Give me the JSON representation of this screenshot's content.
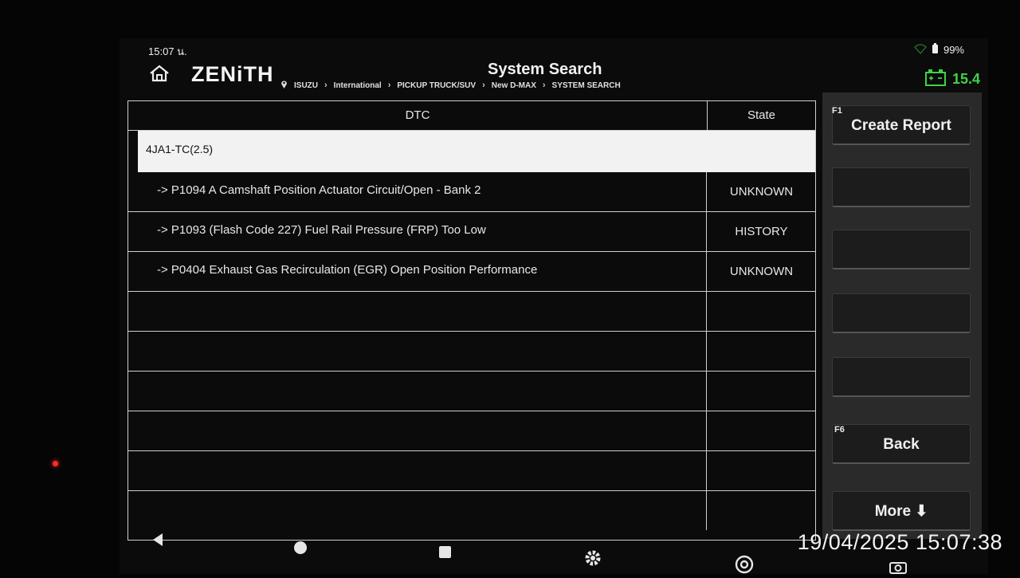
{
  "status_bar": {
    "time": "15:07 น.",
    "battery": "99%"
  },
  "header": {
    "logo": "ZENiTH",
    "title": "System Search",
    "breadcrumb": [
      "ISUZU",
      "International",
      "PICKUP TRUCK/SUV",
      "New D-MAX",
      "SYSTEM SEARCH"
    ],
    "voltage": "15.4"
  },
  "table": {
    "columns": {
      "dtc": "DTC",
      "state": "State"
    },
    "group": "4JA1-TC(2.5)",
    "rows": [
      {
        "dtc": "->  P1094 A Camshaft Position Actuator Circuit/Open - Bank 2",
        "state": "UNKNOWN"
      },
      {
        "dtc": "->  P1093 (Flash Code 227) Fuel Rail Pressure (FRP) Too Low",
        "state": "HISTORY"
      },
      {
        "dtc": "->  P0404 Exhaust Gas Recirculation (EGR) Open Position Performance",
        "state": "UNKNOWN"
      },
      {
        "dtc": "",
        "state": ""
      },
      {
        "dtc": "",
        "state": ""
      },
      {
        "dtc": "",
        "state": ""
      },
      {
        "dtc": "",
        "state": ""
      },
      {
        "dtc": "",
        "state": ""
      },
      {
        "dtc": "",
        "state": ""
      }
    ]
  },
  "function_keys": [
    {
      "num": "F1",
      "label": "Create Report"
    },
    {
      "num": "",
      "label": ""
    },
    {
      "num": "",
      "label": ""
    },
    {
      "num": "",
      "label": ""
    },
    {
      "num": "",
      "label": ""
    },
    {
      "num": "F6",
      "label": "Back"
    },
    {
      "num": "",
      "label": "More ⬇"
    }
  ],
  "overlay": {
    "timestamp": "19/04/2025 15:07:38"
  },
  "colors": {
    "accent_green": "#3fd14a",
    "group_row_bg": "#f2f2f2",
    "fkey_panel": "#2a2a2a"
  }
}
